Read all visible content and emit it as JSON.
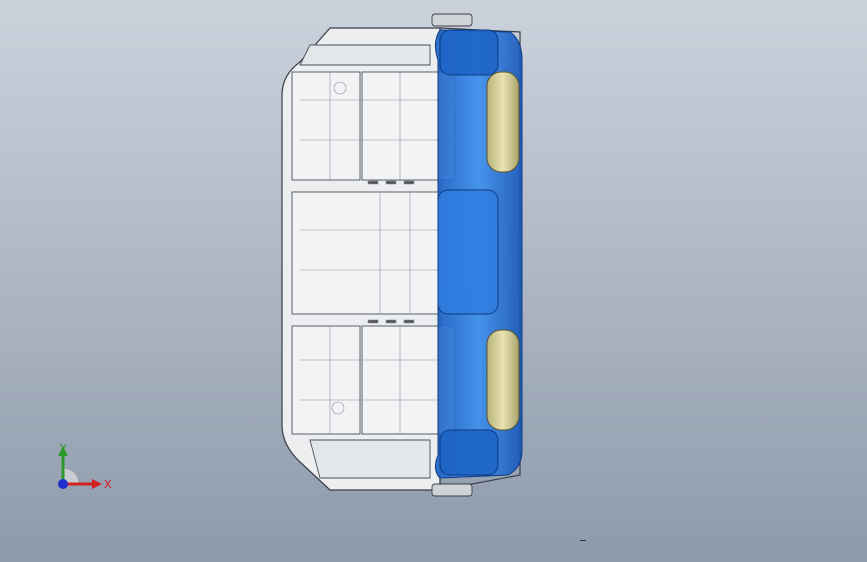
{
  "viewport": {
    "background_top": "#c9d0da",
    "background_bottom": "#8f9bab",
    "model_body_color": "#e9ecef",
    "model_accent_color": "#1f6fd6",
    "model_pad_color": "#d9d49a"
  },
  "triad": {
    "y_label": "Y",
    "x_label": "X",
    "y_color": "#2a9a2a",
    "x_color": "#d02020",
    "origin_color": "#1f2fd0"
  },
  "icons": {
    "triad": "coordinate-triad-icon"
  }
}
